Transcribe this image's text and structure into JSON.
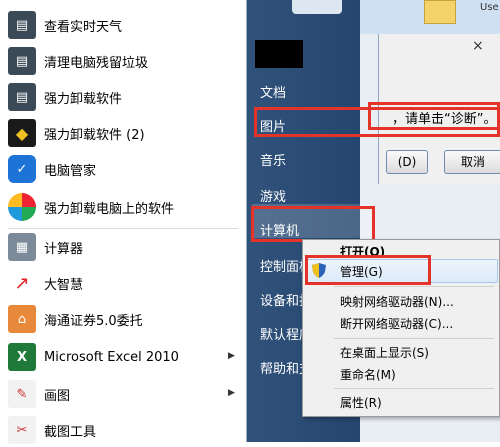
{
  "background": {
    "doc_label": "Use",
    "dialog_text": "，请单击“诊断”。",
    "button_d": "(D)",
    "button_cancel": "取消",
    "close": "×"
  },
  "left_menu": {
    "items": [
      {
        "label": "查看实时天气",
        "icon": "weather-app-icon"
      },
      {
        "label": "清理电脑残留垃圾",
        "icon": "cleanup-app-icon"
      },
      {
        "label": "强力卸载软件",
        "icon": "uninstall-app-icon"
      },
      {
        "label": "强力卸载软件 (2)",
        "icon": "shield-app-icon"
      },
      {
        "label": "电脑管家",
        "icon": "pc-manager-icon"
      },
      {
        "label": "强力卸载电脑上的软件",
        "icon": "colorful-app-icon"
      },
      {
        "label": "计算器",
        "icon": "calculator-icon"
      },
      {
        "label": "大智慧",
        "icon": "stock-chart-icon"
      },
      {
        "label": "海通证券5.0委托",
        "icon": "house-app-icon"
      },
      {
        "label": "Microsoft Excel 2010",
        "icon": "excel-icon"
      },
      {
        "label": "画图",
        "icon": "paint-icon"
      },
      {
        "label": "截图工具",
        "icon": "scissors-icon"
      }
    ],
    "arrow": "▶"
  },
  "right_menu": {
    "items": [
      "文档",
      "图片",
      "音乐",
      "游戏",
      "计算机",
      "控制面板",
      "设备和打",
      "默认程序",
      "帮助和支"
    ]
  },
  "context_menu": {
    "items": [
      "打开(O)",
      "管理(G)",
      "映射网络驱动器(N)...",
      "断开网络驱动器(C)...",
      "在桌面上显示(S)",
      "重命名(M)",
      "属性(R)"
    ]
  },
  "colors": {
    "highlight_red": "#e5332a",
    "start_menu_blue": "#2b4d76"
  }
}
